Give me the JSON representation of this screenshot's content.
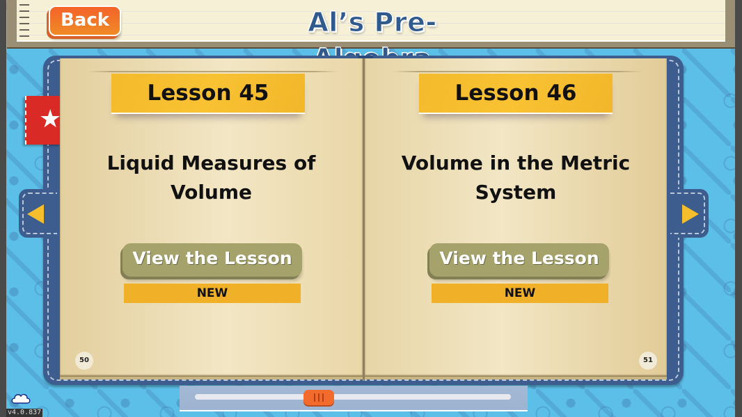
{
  "header": {
    "back_label": "Back",
    "app_title": "Al’s Pre-Algebra"
  },
  "pages": [
    {
      "lesson_label": "Lesson 45",
      "title_lines": [
        "Liquid Measures of",
        "Volume"
      ],
      "view_label": "View the Lesson",
      "status_badge": "NEW",
      "page_number": "50"
    },
    {
      "lesson_label": "Lesson 46",
      "title_lines": [
        "Volume in the Metric",
        "System"
      ],
      "view_label": "View the Lesson",
      "status_badge": "NEW",
      "page_number": "51"
    }
  ],
  "navigation": {
    "prev_icon": "triangle-left-icon",
    "next_icon": "triangle-right-icon",
    "bookmark_icon": "star-icon"
  },
  "slider": {
    "position_fraction": 0.38
  },
  "footer": {
    "cloud_icon": "cloud-icon",
    "version": "v4.0.837"
  },
  "colors": {
    "accent_orange": "#f26b2d",
    "title_blue": "#30598e",
    "banner_yellow": "#f8c233",
    "book_blue": "#3d5d8e",
    "button_olive": "#a6a26c",
    "bookmark_red": "#d92a26"
  }
}
